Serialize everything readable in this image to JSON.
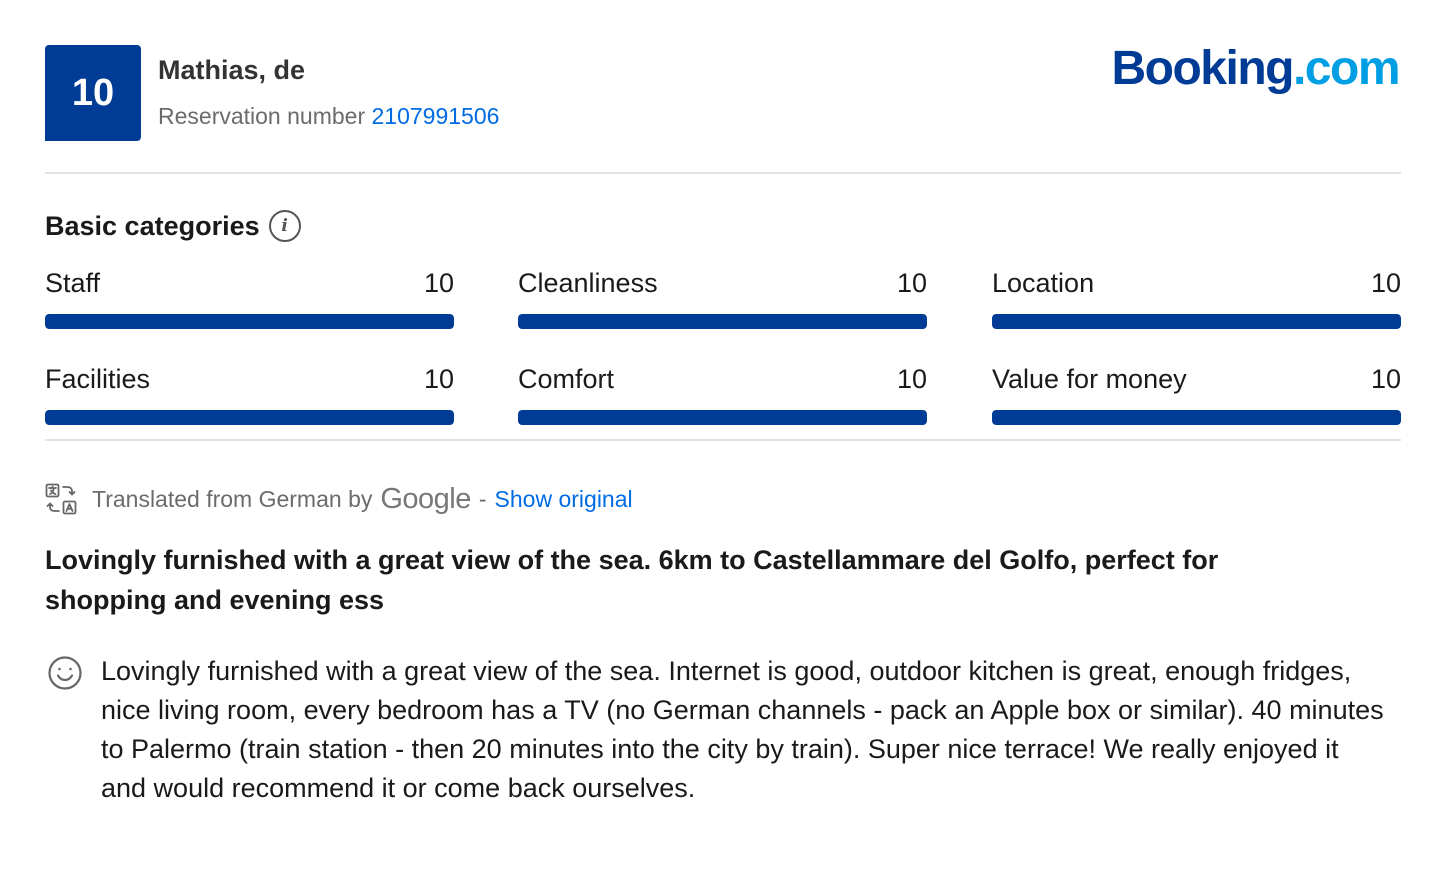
{
  "review": {
    "score": "10",
    "reviewer": "Mathias, de",
    "reservation_label": "Reservation number",
    "reservation_number": "2107991506"
  },
  "logo": {
    "booking": "Booking",
    "dotcom": ".com",
    "brand_color": "#003b95",
    "accent_color": "#009fe3"
  },
  "categories": {
    "title": "Basic categories",
    "items": [
      {
        "label": "Staff",
        "value": "10",
        "fill": 1.0
      },
      {
        "label": "Cleanliness",
        "value": "10",
        "fill": 1.0
      },
      {
        "label": "Location",
        "value": "10",
        "fill": 1.0
      },
      {
        "label": "Facilities",
        "value": "10",
        "fill": 1.0
      },
      {
        "label": "Comfort",
        "value": "10",
        "fill": 1.0
      },
      {
        "label": "Value for money",
        "value": "10",
        "fill": 1.0
      }
    ]
  },
  "translation": {
    "text": "Translated from German by",
    "provider": "Google",
    "separator": "-",
    "show_original": "Show original"
  },
  "review_title": "Lovingly furnished with a great view of the sea. 6km to Castellammare del Golfo, perfect for shopping and evening ess",
  "review_text": "Lovingly furnished with a great view of the sea. Internet is good, outdoor kitchen is great, enough fridges, nice living room, every bedroom has a TV (no German channels - pack an Apple box or similar). 40 minutes to Palermo (train station - then 20 minutes into the city by train). Super nice terrace! We really enjoyed it and would recommend it or come back ourselves.",
  "icons": {
    "info": "info-icon",
    "translate": "translate-icon",
    "positive": "smiley-icon"
  }
}
